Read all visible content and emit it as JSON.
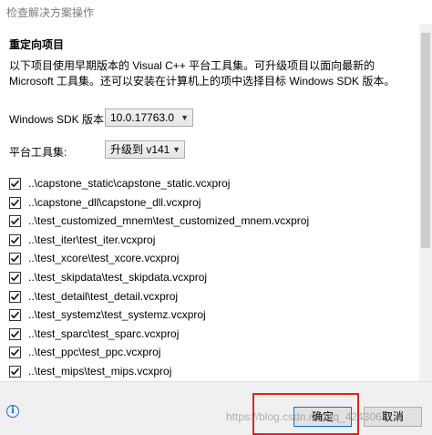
{
  "window": {
    "title": "检查解决方案操作"
  },
  "header": {
    "section_title": "重定向项目",
    "description": "以下项目使用早期版本的 Visual C++ 平台工具集。可升级项目以面向最新的 Microsoft 工具集。还可以安装在计算机上的项中选择目标 Windows SDK 版本。"
  },
  "settings": {
    "sdk_label": "Windows SDK 版本:",
    "sdk_value": "10.0.17763.0",
    "toolset_label": "平台工具集:",
    "toolset_value": "升级到 v141"
  },
  "projects": [
    {
      "label": "..\\capstone_static\\capstone_static.vcxproj",
      "checked": true
    },
    {
      "label": "..\\capstone_dll\\capstone_dll.vcxproj",
      "checked": true
    },
    {
      "label": "..\\test_customized_mnem\\test_customized_mnem.vcxproj",
      "checked": true
    },
    {
      "label": "..\\test_iter\\test_iter.vcxproj",
      "checked": true
    },
    {
      "label": "..\\test_xcore\\test_xcore.vcxproj",
      "checked": true
    },
    {
      "label": "..\\test_skipdata\\test_skipdata.vcxproj",
      "checked": true
    },
    {
      "label": "..\\test_detail\\test_detail.vcxproj",
      "checked": true
    },
    {
      "label": "..\\test_systemz\\test_systemz.vcxproj",
      "checked": true
    },
    {
      "label": "..\\test_sparc\\test_sparc.vcxproj",
      "checked": true
    },
    {
      "label": "..\\test_ppc\\test_ppc.vcxproj",
      "checked": true
    },
    {
      "label": "..\\test_mips\\test_mips.vcxproj",
      "checked": true
    }
  ],
  "footer": {
    "info_icon": "info-icon",
    "ok_label": "确定",
    "cancel_label": "取消",
    "watermark": "https://blog.csdn.net/qq_42430611"
  },
  "colors": {
    "highlight": "#e32222",
    "accent": "#0078d7"
  }
}
